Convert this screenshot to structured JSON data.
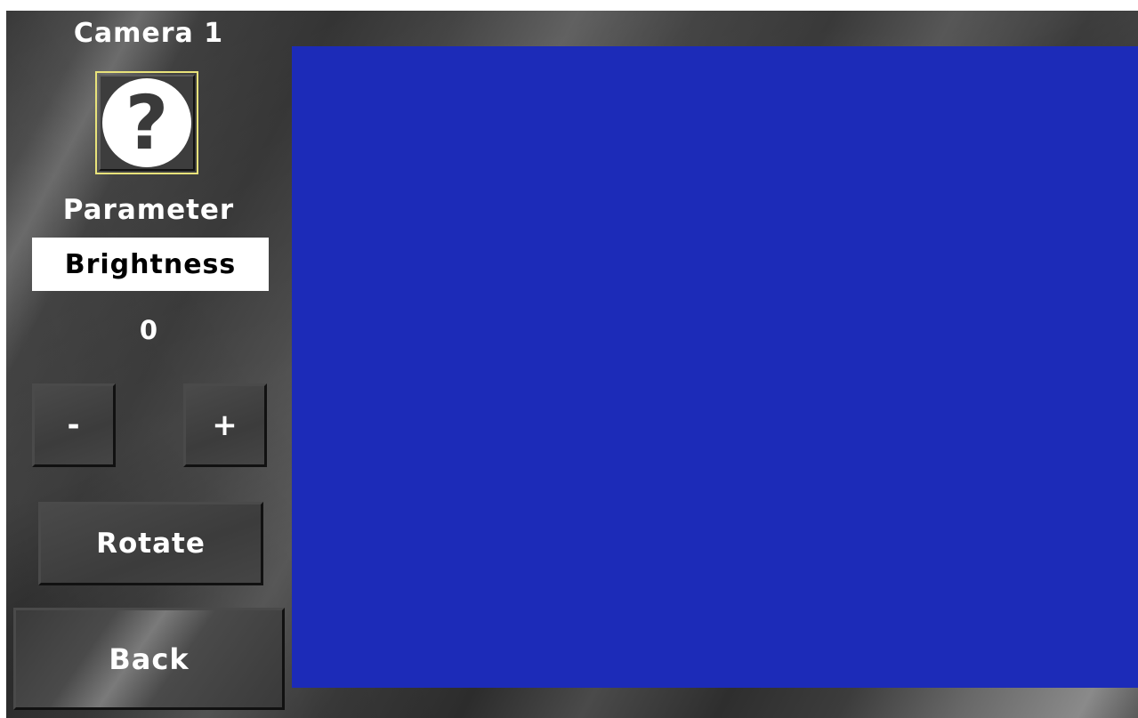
{
  "camera": {
    "title": "Camera 1",
    "status_icon": "question-mark-icon",
    "status_glyph": "?"
  },
  "parameter": {
    "label": "Parameter",
    "selected": "Brightness",
    "value": "0"
  },
  "controls": {
    "decrement_label": "-",
    "increment_label": "+",
    "rotate_label": "Rotate",
    "back_label": "Back"
  },
  "colors": {
    "video_background": "#1c2bb8",
    "status_highlight": "#e8e27a",
    "text": "#ffffff"
  }
}
